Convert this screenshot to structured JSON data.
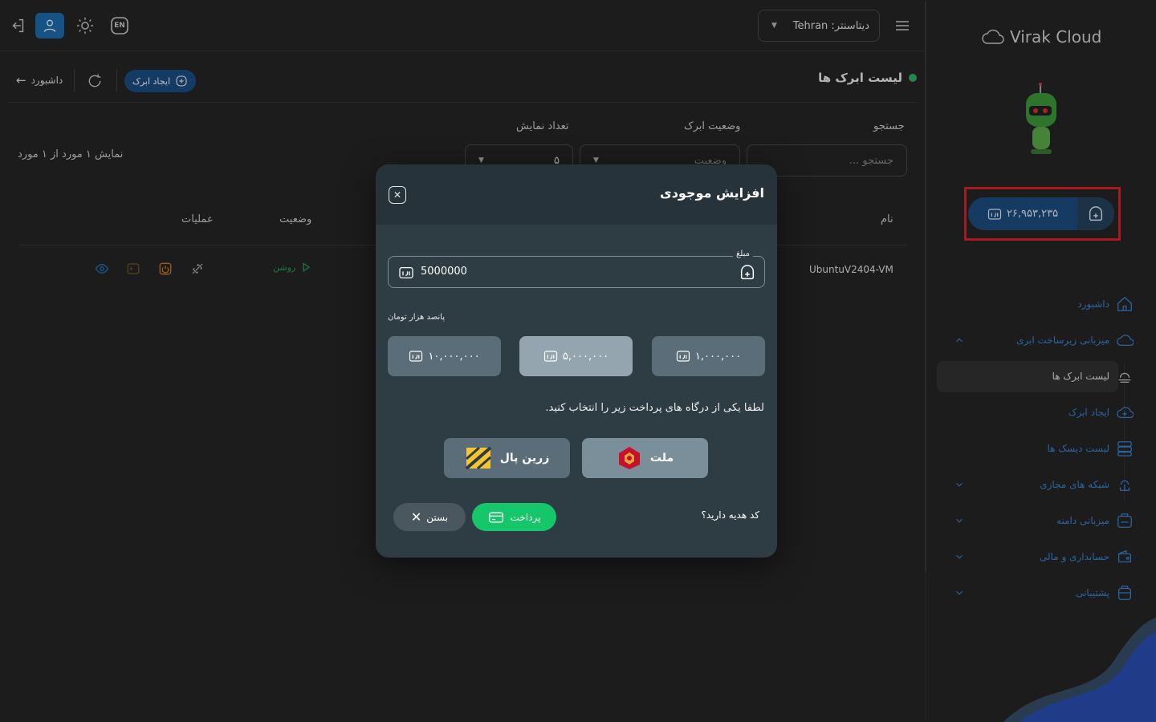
{
  "topbar": {
    "icons": [
      "logout-icon",
      "user-icon",
      "sun-icon",
      "en-icon"
    ],
    "lang_label": "EN",
    "datacenter_label": "دیتاسنتر: Tehran",
    "datacenter_city": "Tehran"
  },
  "page": {
    "title": "لیست ابرک ها",
    "create_button": "ایجاد ابرک",
    "dashboard_link": "داشبورد"
  },
  "filters": {
    "search_label": "جستجو",
    "search_placeholder": "جستجو ...",
    "status_label": "وضعیت ابرک",
    "status_placeholder": "وضعیت",
    "per_page_label": "تعداد نمایش",
    "per_page_value": "۵",
    "showing_text": "نمایش ۱ مورد از ۱ مورد"
  },
  "table": {
    "headers": {
      "name": "نام",
      "status": "وضعیت",
      "operations": "عملیات"
    },
    "rows": [
      {
        "name": "UbuntuV2404-VM",
        "status": "روشن"
      }
    ]
  },
  "sidebar": {
    "logo_text": "Virak Cloud",
    "balance": "۲۶,۹۵۳,۲۳۵",
    "nav": [
      {
        "label": "داشبورد",
        "icon": "home-icon"
      },
      {
        "label": "میزبانی زیرساخت ابری",
        "icon": "cloud-icon"
      },
      {
        "label": "لیست ابرک ها",
        "icon": "layers-icon"
      },
      {
        "label": "ایجاد ابرک",
        "icon": "cloud-plus-icon"
      },
      {
        "label": "لیست دیسک ها",
        "icon": "server-icon"
      },
      {
        "label": "شبکه های مجازی",
        "icon": "network-icon"
      },
      {
        "label": "میزبانی دامنه",
        "icon": "domain-icon"
      },
      {
        "label": "حسابداری و مالی",
        "icon": "wallet-icon"
      },
      {
        "label": "پشتیبانی",
        "icon": "support-icon"
      }
    ]
  },
  "modal": {
    "title": "افزایش موجودی",
    "amount_label": "مبلغ",
    "amount_value": "5000000",
    "amount_words": "پانصد هزار تومان",
    "presets": [
      "۱۰,۰۰۰,۰۰۰",
      "۵,۰۰۰,۰۰۰",
      "۱,۰۰۰,۰۰۰"
    ],
    "selected_preset": "۵,۰۰۰,۰۰۰",
    "gateway_message": "لطفا یکی از درگاه های پرداخت زیر را انتخاب کنید.",
    "gateways": [
      "زرین پال",
      "ملت"
    ],
    "gift_question": "کد هدیه دارید؟",
    "pay_button": "پرداخت",
    "close_button": "بستن"
  },
  "colors": {
    "accent": "#1e6fb0",
    "pay": "#15c76a",
    "status_on": "#26a65b",
    "highlight_frame": "#e0222b"
  }
}
